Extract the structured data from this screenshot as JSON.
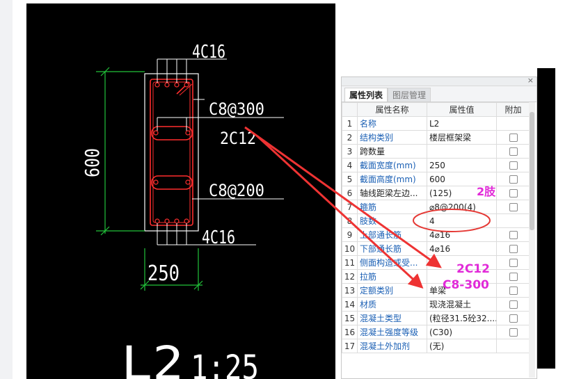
{
  "drawing": {
    "top_bar_label": "4C16",
    "stirrup_label_1": "C8@300",
    "waist_bar_label": "2C12",
    "stirrup_label_2": "C8@200",
    "bottom_bar_label": "4C16",
    "height_dim": "600",
    "width_dim": "250",
    "title": "L2",
    "scale": "1:25"
  },
  "panel": {
    "close_glyph": "×",
    "tabs": [
      {
        "label": "属性列表",
        "active": true
      },
      {
        "label": "图层管理",
        "active": false
      }
    ],
    "columns": [
      "属性名称",
      "属性值",
      "附加"
    ],
    "rows": [
      {
        "num": "1",
        "name": "名称",
        "value": "L2",
        "link": true,
        "checkbox": false
      },
      {
        "num": "2",
        "name": "结构类别",
        "value": "楼层框架梁",
        "link": true,
        "checkbox": true
      },
      {
        "num": "3",
        "name": "跨数量",
        "value": "",
        "link": false,
        "checkbox": true
      },
      {
        "num": "4",
        "name": "截面宽度(mm)",
        "value": "250",
        "link": true,
        "checkbox": true
      },
      {
        "num": "5",
        "name": "截面高度(mm)",
        "value": "600",
        "link": true,
        "checkbox": true
      },
      {
        "num": "6",
        "name": "轴线距梁左边...",
        "value": "(125)",
        "link": false,
        "checkbox": true
      },
      {
        "num": "7",
        "name": "箍筋",
        "value": "⌀8@200(4)",
        "link": true,
        "checkbox": true
      },
      {
        "num": "8",
        "name": "肢数",
        "value": "4",
        "link": true,
        "checkbox": false
      },
      {
        "num": "9",
        "name": "上部通长筋",
        "value": "4⌀16",
        "link": true,
        "checkbox": true
      },
      {
        "num": "10",
        "name": "下部通长筋",
        "value": "4⌀16",
        "link": true,
        "checkbox": true
      },
      {
        "num": "11",
        "name": "侧面构造或受...",
        "value": "",
        "link": true,
        "checkbox": true
      },
      {
        "num": "12",
        "name": "拉筋",
        "value": "",
        "link": true,
        "checkbox": true
      },
      {
        "num": "13",
        "name": "定额类别",
        "value": "单梁",
        "link": true,
        "checkbox": true
      },
      {
        "num": "14",
        "name": "材质",
        "value": "现浇混凝土",
        "link": true,
        "checkbox": true
      },
      {
        "num": "15",
        "name": "混凝土类型",
        "value": "(粒径31.5砼32....",
        "link": true,
        "checkbox": true
      },
      {
        "num": "16",
        "name": "混凝土强度等级",
        "value": "(C30)",
        "link": true,
        "checkbox": true
      },
      {
        "num": "17",
        "name": "混凝土外加剂",
        "value": "(无)",
        "link": true,
        "checkbox": false
      }
    ]
  },
  "annotations": {
    "limbs": "2肢",
    "waist": "2C12",
    "tie": "C8-300"
  },
  "colors": {
    "cad_background": "#000000",
    "cad_lines": "#ffffff",
    "dimension": "#22c33b",
    "rebar": "#ff2e2e",
    "annotation_text": "#e12ad8",
    "arrow": "#ee3333",
    "link_text": "#1a5fb4"
  }
}
